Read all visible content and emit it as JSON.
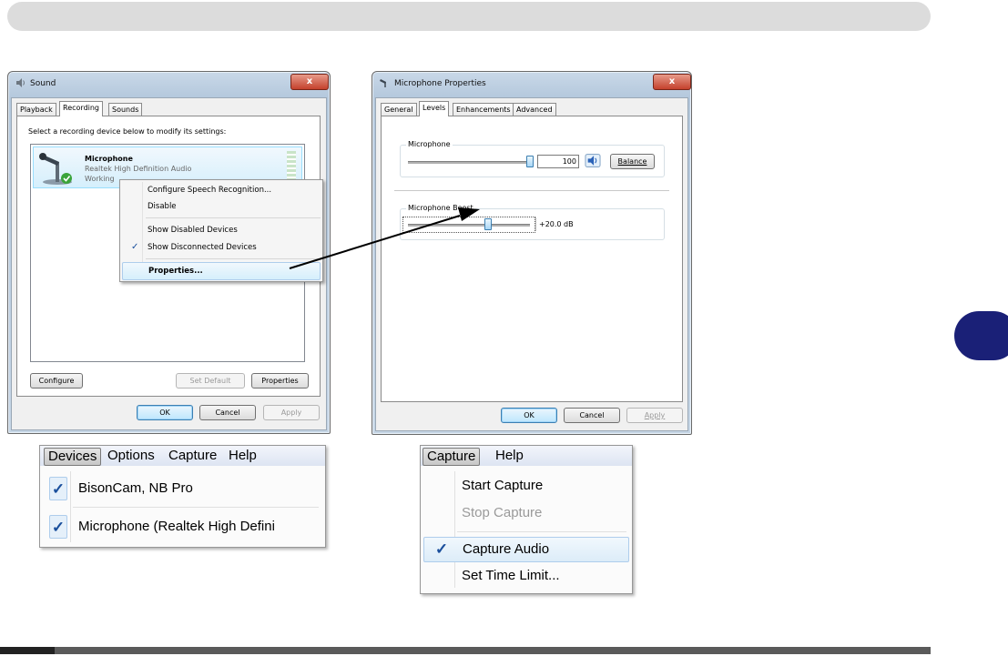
{
  "sound_dialog": {
    "title": "Sound",
    "close": "x",
    "tabs": [
      "Playback",
      "Recording",
      "Sounds"
    ],
    "instruction": "Select a recording device below to modify its settings:",
    "device": {
      "name": "Microphone",
      "driver": "Realtek High Definition Audio",
      "status": "Working"
    },
    "buttons": {
      "configure": "Configure",
      "set_default": "Set Default",
      "properties": "Properties",
      "ok": "OK",
      "cancel": "Cancel",
      "apply": "Apply"
    }
  },
  "context_menu": {
    "items": [
      {
        "label": "Configure Speech Recognition..."
      },
      {
        "label": "Disable"
      },
      {
        "label": "Show Disabled Devices"
      },
      {
        "label": "Show Disconnected Devices",
        "checked": true
      },
      {
        "label": "Properties...",
        "highlighted": true
      }
    ],
    "check_glyph": "✓"
  },
  "mic_properties": {
    "title": "Microphone Properties",
    "close": "x",
    "tabs": [
      "General",
      "Levels",
      "Enhancements",
      "Advanced"
    ],
    "microphone_group": {
      "label": "Microphone",
      "value": "100",
      "level_fraction": 1.0,
      "balance_button": "Balance"
    },
    "boost_group": {
      "label": "Microphone Boost",
      "value": "+20.0 dB",
      "level_fraction": 0.66
    },
    "buttons": {
      "ok": "OK",
      "cancel": "Cancel",
      "apply": "Apply"
    }
  },
  "devices_menu": {
    "menubar": [
      "Devices",
      "Options",
      "Capture",
      "Help"
    ],
    "items": [
      {
        "label": "BisonCam, NB Pro",
        "checked": true
      },
      {
        "label": "Microphone (Realtek High Defini",
        "checked": true
      }
    ],
    "check_glyph": "✓"
  },
  "capture_menu": {
    "menubar": [
      "Capture",
      "Help"
    ],
    "items": [
      {
        "label": "Start Capture"
      },
      {
        "label": "Stop Capture",
        "disabled": true
      },
      {
        "label": "Capture Audio",
        "checked": true,
        "highlighted": true
      },
      {
        "label": "Set Time Limit..."
      }
    ],
    "check_glyph": "✓"
  },
  "colors": {
    "side_tab": "#1a2077",
    "banner": "#dcdcdc",
    "arrow": "#000000"
  }
}
